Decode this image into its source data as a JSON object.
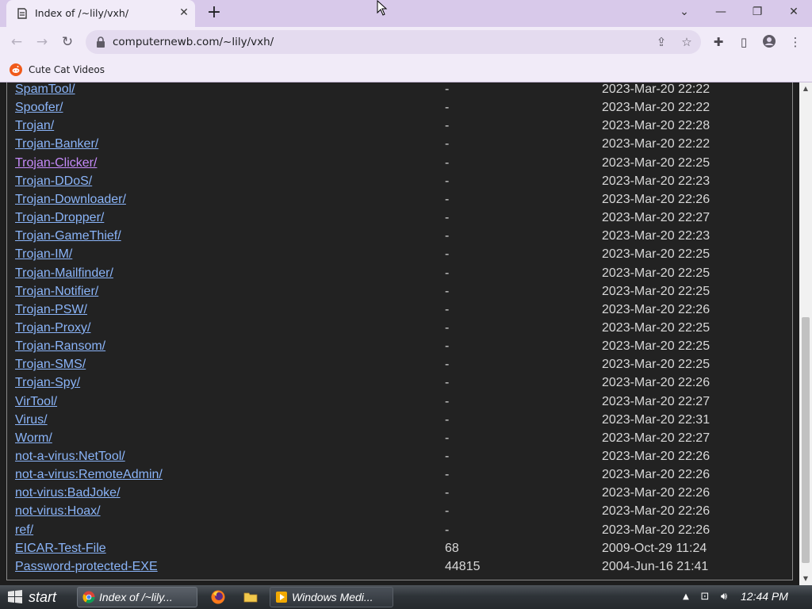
{
  "browser": {
    "tab_title": "Index of /~lily/vxh/",
    "tab_close": "✕",
    "new_tab": "+",
    "url": "computernewb.com/~lily/vxh/",
    "bookmarks": [
      {
        "label": "Cute Cat Videos"
      }
    ]
  },
  "listing": {
    "rows": [
      {
        "name": "SpamTool/",
        "size": "-",
        "date": "2023-Mar-20 22:22",
        "visited": false
      },
      {
        "name": "Spoofer/",
        "size": "-",
        "date": "2023-Mar-20 22:22",
        "visited": false
      },
      {
        "name": "Trojan/",
        "size": "-",
        "date": "2023-Mar-20 22:28",
        "visited": false
      },
      {
        "name": "Trojan-Banker/",
        "size": "-",
        "date": "2023-Mar-20 22:22",
        "visited": false
      },
      {
        "name": "Trojan-Clicker/",
        "size": "-",
        "date": "2023-Mar-20 22:25",
        "visited": true
      },
      {
        "name": "Trojan-DDoS/",
        "size": "-",
        "date": "2023-Mar-20 22:23",
        "visited": false
      },
      {
        "name": "Trojan-Downloader/",
        "size": "-",
        "date": "2023-Mar-20 22:26",
        "visited": false
      },
      {
        "name": "Trojan-Dropper/",
        "size": "-",
        "date": "2023-Mar-20 22:27",
        "visited": false
      },
      {
        "name": "Trojan-GameThief/",
        "size": "-",
        "date": "2023-Mar-20 22:23",
        "visited": false
      },
      {
        "name": "Trojan-IM/",
        "size": "-",
        "date": "2023-Mar-20 22:25",
        "visited": false
      },
      {
        "name": "Trojan-Mailfinder/",
        "size": "-",
        "date": "2023-Mar-20 22:25",
        "visited": false
      },
      {
        "name": "Trojan-Notifier/",
        "size": "-",
        "date": "2023-Mar-20 22:25",
        "visited": false
      },
      {
        "name": "Trojan-PSW/",
        "size": "-",
        "date": "2023-Mar-20 22:26",
        "visited": false
      },
      {
        "name": "Trojan-Proxy/",
        "size": "-",
        "date": "2023-Mar-20 22:25",
        "visited": false
      },
      {
        "name": "Trojan-Ransom/",
        "size": "-",
        "date": "2023-Mar-20 22:25",
        "visited": false
      },
      {
        "name": "Trojan-SMS/",
        "size": "-",
        "date": "2023-Mar-20 22:25",
        "visited": false
      },
      {
        "name": "Trojan-Spy/",
        "size": "-",
        "date": "2023-Mar-20 22:26",
        "visited": false
      },
      {
        "name": "VirTool/",
        "size": "-",
        "date": "2023-Mar-20 22:27",
        "visited": false
      },
      {
        "name": "Virus/",
        "size": "-",
        "date": "2023-Mar-20 22:31",
        "visited": false
      },
      {
        "name": "Worm/",
        "size": "-",
        "date": "2023-Mar-20 22:27",
        "visited": false
      },
      {
        "name": "not-a-virus:NetTool/",
        "size": "-",
        "date": "2023-Mar-20 22:26",
        "visited": false
      },
      {
        "name": "not-a-virus:RemoteAdmin/",
        "size": "-",
        "date": "2023-Mar-20 22:26",
        "visited": false
      },
      {
        "name": "not-virus:BadJoke/",
        "size": "-",
        "date": "2023-Mar-20 22:26",
        "visited": false
      },
      {
        "name": "not-virus:Hoax/",
        "size": "-",
        "date": "2023-Mar-20 22:26",
        "visited": false
      },
      {
        "name": "ref/",
        "size": "-",
        "date": "2023-Mar-20 22:26",
        "visited": false
      },
      {
        "name": "EICAR-Test-File",
        "size": "68",
        "date": "2009-Oct-29 11:24",
        "visited": false
      },
      {
        "name": "Password-protected-EXE",
        "size": "44815",
        "date": "2004-Jun-16 21:41",
        "visited": false
      }
    ]
  },
  "taskbar": {
    "start_label": "start",
    "tasks": [
      {
        "label": "Index of /~lily...",
        "icon": "chrome-icon",
        "active": true
      },
      {
        "label": "Windows Medi...",
        "icon": "media-player-icon",
        "active": false
      }
    ],
    "clock": "12:44 PM"
  },
  "colors": {
    "link": "#8ab4f8",
    "visited_link": "#c58af9",
    "page_background": "#222222",
    "tabstrip": "#d8c9ea"
  }
}
